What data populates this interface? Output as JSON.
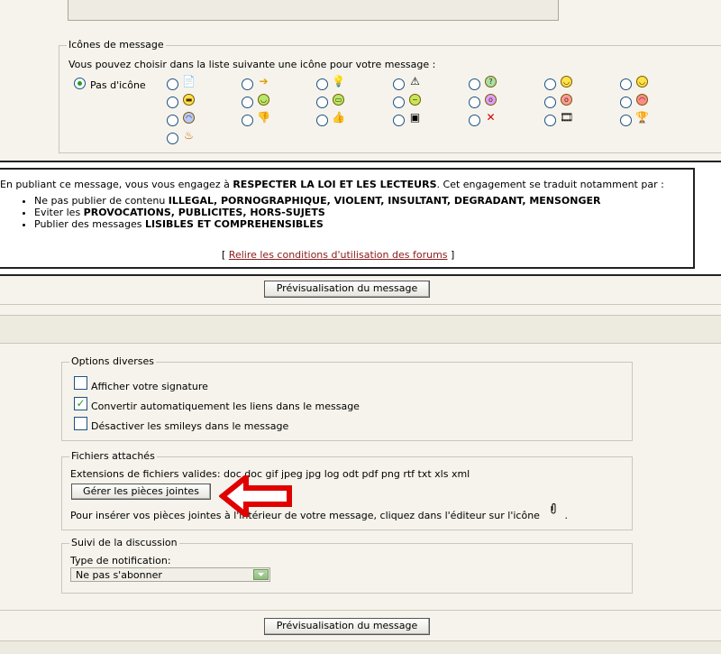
{
  "icons_section": {
    "legend": "Icônes de message",
    "intro": "Vous pouvez choisir dans la liste suivante une icône pour votre message :",
    "no_icon_label": "Pas d'icône",
    "icons": [
      {
        "name": "note-icon",
        "glyph": "📄"
      },
      {
        "name": "arrow-right-icon",
        "glyph": "➔"
      },
      {
        "name": "lightbulb-icon",
        "glyph": "💡"
      },
      {
        "name": "warning-icon",
        "glyph": "⚠"
      },
      {
        "name": "question-icon",
        "glyph": "?"
      },
      {
        "name": "smile-icon",
        "glyph": "◡"
      },
      {
        "name": "wink-icon",
        "glyph": "◡"
      },
      {
        "name": "cool-icon",
        "glyph": "▬"
      },
      {
        "name": "happy-icon",
        "glyph": "◡"
      },
      {
        "name": "grin-icon",
        "glyph": "▭"
      },
      {
        "name": "sick-icon",
        "glyph": "~"
      },
      {
        "name": "embarrassed-icon",
        "glyph": "o"
      },
      {
        "name": "blush-icon",
        "glyph": "o"
      },
      {
        "name": "angry-icon",
        "glyph": "◠"
      },
      {
        "name": "sad-icon",
        "glyph": "◠"
      },
      {
        "name": "thumbs-down-icon",
        "glyph": "👎"
      },
      {
        "name": "thumbs-up-icon",
        "glyph": "👍"
      },
      {
        "name": "box-icon",
        "glyph": "▣"
      },
      {
        "name": "crossed-icon",
        "glyph": "✕"
      },
      {
        "name": "film-icon",
        "glyph": "🎞"
      },
      {
        "name": "trophy-icon",
        "glyph": "🏆"
      },
      {
        "name": "flames-icon",
        "glyph": "♨"
      }
    ]
  },
  "rules": {
    "intro_pre": "En publiant ce message, vous vous engagez à ",
    "intro_bold": "RESPECTER LA LOI ET LES LECTEURS",
    "intro_post": ". Cet engagement se traduit notamment par :",
    "b1_pre": "Ne pas publier de contenu ",
    "b1_bold": "ILLEGAL, PORNOGRAPHIQUE, VIOLENT, INSULTANT, DEGRADANT, MENSONGER",
    "b2_pre": "Eviter les ",
    "b2_bold": "PROVOCATIONS, PUBLICITES, HORS-SUJETS",
    "b3_pre": "Publier des messages ",
    "b3_bold": "LISIBLES ET COMPREHENSIBLES",
    "link_open": "[ ",
    "link_text": "Relire les conditions d'utilisation des forums",
    "link_close": " ]"
  },
  "preview_button": "Prévisualisation du message",
  "options": {
    "legend": "Options diverses",
    "items": [
      {
        "label": "Afficher votre signature",
        "checked": false
      },
      {
        "label": "Convertir automatiquement les liens dans le message",
        "checked": true
      },
      {
        "label": "Désactiver les smileys dans le message",
        "checked": false
      }
    ]
  },
  "attachments": {
    "legend": "Fichiers attachés",
    "extensions": "Extensions de fichiers valides: doc doc gif jpeg jpg log odt pdf png rtf txt xls xml",
    "manage_button": "Gérer les pièces jointes",
    "hint": "Pour insérer vos pièces jointes à l'intérieur de votre message, cliquez dans l'éditeur sur l'icône",
    "hint_end": ".",
    "annotation_color": "#e00000"
  },
  "follow": {
    "legend": "Suivi de la discussion",
    "type_label": "Type de notification:",
    "selected": "Ne pas s'abonner"
  }
}
